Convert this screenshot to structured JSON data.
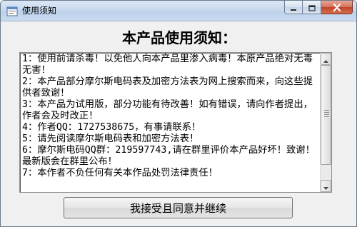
{
  "window": {
    "title": "使用须知",
    "icon": "app-icon"
  },
  "controls": {
    "minimize_icon": "minimize-icon",
    "maximize_icon": "maximize-icon",
    "close_icon": "close-icon"
  },
  "heading": "本产品使用须知：",
  "notice": {
    "lines": [
      "1：使用前请杀毒！以免他人向本产品里渗入病毒！本原产品绝对无毒无害！",
      "2：本产品部分摩尔斯电码表及加密方法表为网上搜索而来，向这些提供者致谢！",
      "3：本产品为试用版，部分功能有待改善！如有错误，请向作者提出，作者会及时改正！",
      "4：作者QQ：1727538675，有事请联系！",
      "5：请先阅读摩尔斯电码表和加密方法表！",
      "6：摩尔斯电码QQ群：219597743,请在群里评价本产品好坏！致谢！最新版会在群里公布！",
      "7：本作者不负任何有关本作品处罚法律责任！"
    ]
  },
  "accept_button": "我接受且同意并继续",
  "colors": {
    "close_button": "#c1442b",
    "titlebar": "#c6d8ee"
  }
}
